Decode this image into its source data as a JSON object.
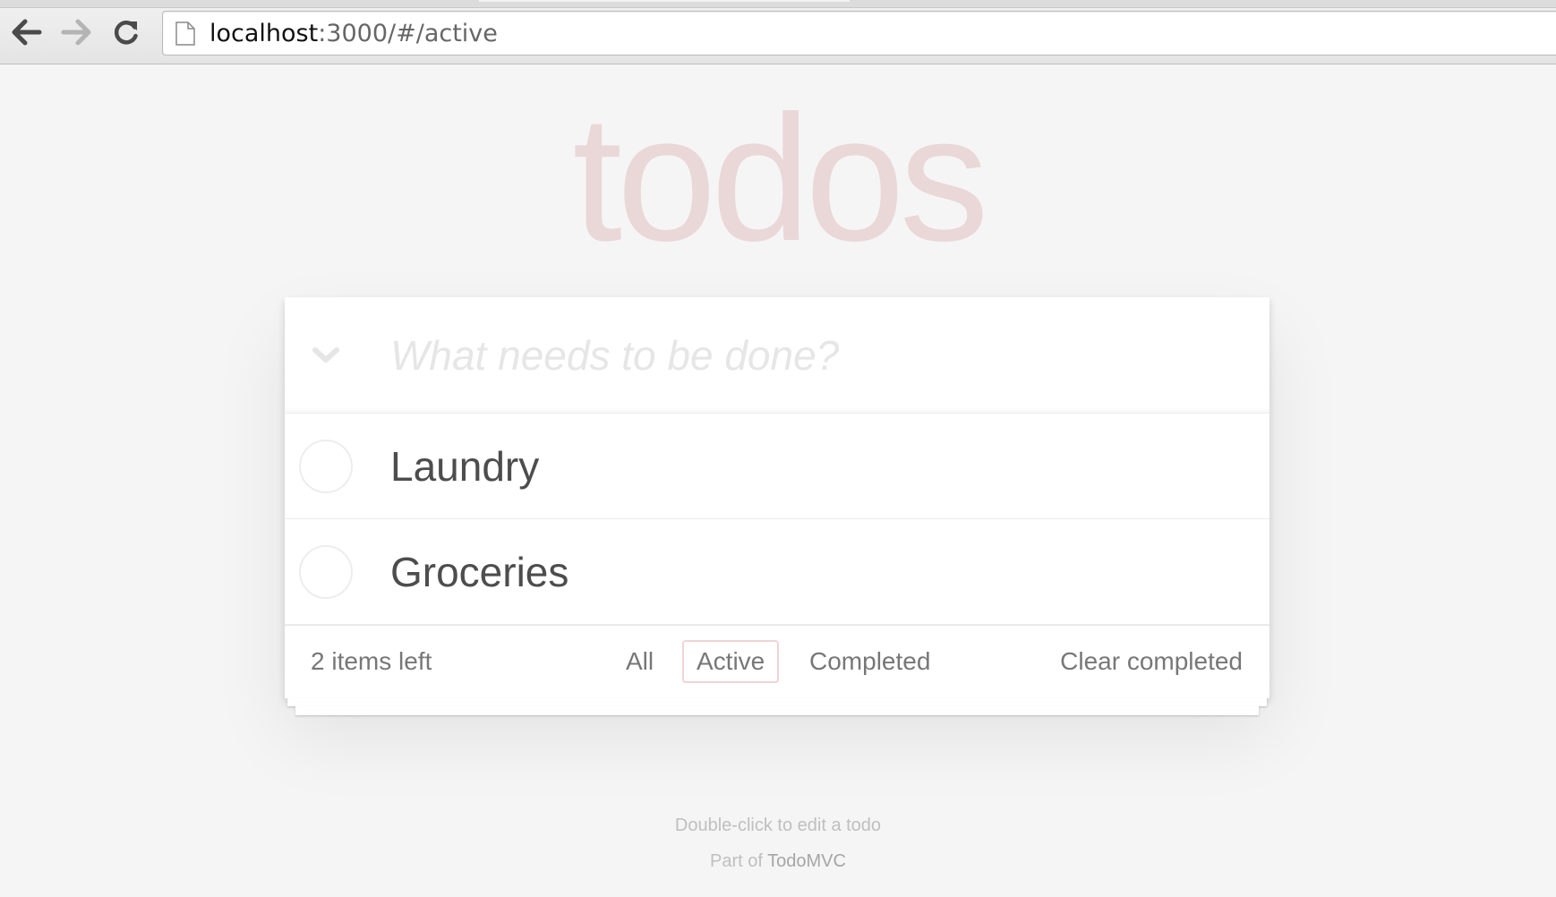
{
  "browser": {
    "url_host": "localhost",
    "url_rest": ":3000/#/active",
    "icons": {
      "back": "back-arrow-icon",
      "forward": "forward-arrow-icon",
      "reload": "reload-icon",
      "page": "page-icon"
    }
  },
  "app": {
    "title": "todos",
    "title_color": "#af2f2f",
    "new_todo_placeholder": "What needs to be done?",
    "new_todo_value": "",
    "toggle_all_icon": "chevron-down-icon"
  },
  "todos": [
    {
      "label": "Laundry",
      "completed": false
    },
    {
      "label": "Groceries",
      "completed": false
    }
  ],
  "footer": {
    "items_left": "2 items left",
    "filters": [
      {
        "label": "All",
        "selected": false
      },
      {
        "label": "Active",
        "selected": true
      },
      {
        "label": "Completed",
        "selected": false
      }
    ],
    "clear_completed": "Clear completed"
  },
  "info": {
    "hint": "Double-click to edit a todo",
    "part_of_prefix": "Part of ",
    "part_of_link": "TodoMVC"
  }
}
